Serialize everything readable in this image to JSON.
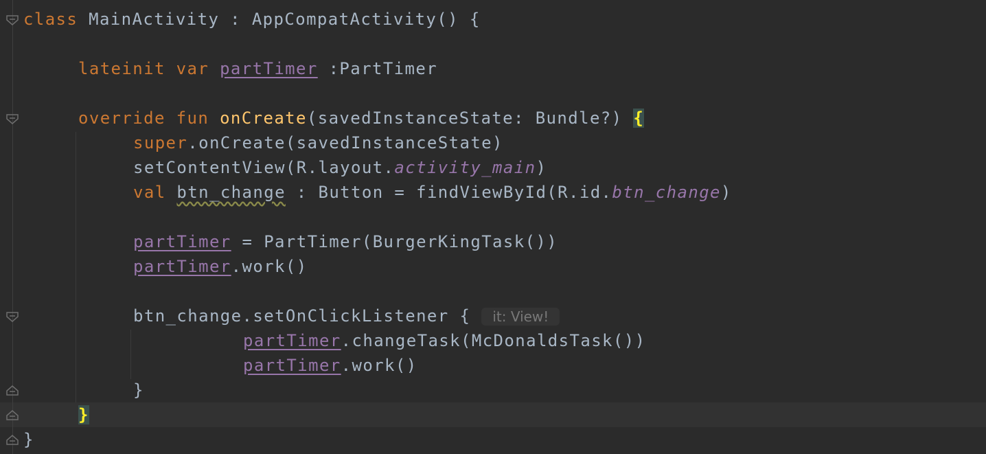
{
  "lines": {
    "l1": {
      "kw_class": "class",
      "rest": " MainActivity : AppCompatActivity() {"
    },
    "l2": {
      "kw_lateinit": "lateinit",
      "sp1": " ",
      "kw_var": "var",
      "sp2": " ",
      "prop": "partTimer",
      "rest": " :PartTimer"
    },
    "l3": {
      "kw_override": "override",
      "sp1": " ",
      "kw_fun": "fun",
      "sp2": " ",
      "fn": "onCreate",
      "rest": "(savedInstanceState: Bundle?) ",
      "brace": "{"
    },
    "l4": {
      "kw_super": "super",
      "rest": ".onCreate(savedInstanceState)"
    },
    "l5": {
      "pre": "setContentView(R.layout.",
      "ital": "activity_main",
      "post": ")"
    },
    "l6": {
      "kw_val": "val",
      "sp": " ",
      "squig": "btn_change",
      "mid": " : Button = findViewById(R.id.",
      "ital": "btn_change",
      "post": ")"
    },
    "l7": {
      "prop": "partTimer",
      "rest": " = PartTimer(BurgerKingTask())"
    },
    "l8": {
      "prop": "partTimer",
      "rest": ".work()"
    },
    "l9": {
      "code": "btn_change.setOnClickListener {",
      "hint": "it: View!"
    },
    "l10": {
      "prop": "partTimer",
      "rest": ".changeTask(McDonaldsTask())"
    },
    "l11": {
      "prop": "partTimer",
      "rest": ".work()"
    },
    "l12": {
      "code": "}"
    },
    "l13": {
      "brace": "}"
    },
    "l14": {
      "code": "}"
    }
  },
  "colors": {
    "background": "#2b2b2b",
    "default_text": "#a9b7c6",
    "keyword": "#cc7832",
    "function": "#ffc66d",
    "property": "#9876aa",
    "brace_highlight": "#ffef28"
  },
  "icons": {
    "fold_open": "fold-open-icon",
    "fold_close": "fold-close-icon"
  }
}
